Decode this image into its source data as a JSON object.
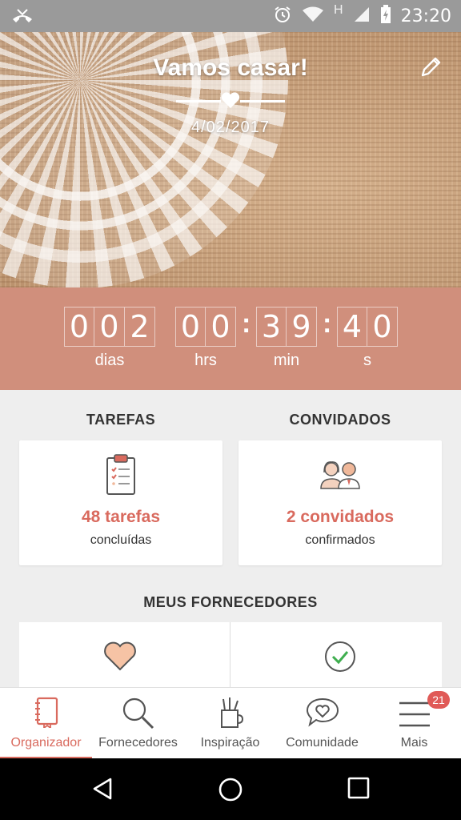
{
  "status_bar": {
    "time": "23:20",
    "network_letter": "H"
  },
  "hero": {
    "title": "Vamos casar!",
    "date": "4/02/2017"
  },
  "countdown": {
    "days": [
      "0",
      "0",
      "2"
    ],
    "hours": [
      "0",
      "0"
    ],
    "minutes": [
      "3",
      "9"
    ],
    "seconds": [
      "4",
      "0"
    ],
    "labels": {
      "days": "dias",
      "hours": "hrs",
      "minutes": "min",
      "seconds": "s"
    }
  },
  "tasks": {
    "heading": "TAREFAS",
    "count": "48 tarefas",
    "sub": "concluídas"
  },
  "guests": {
    "heading": "CONVIDADOS",
    "count": "2 convidados",
    "sub": "confirmados"
  },
  "suppliers": {
    "heading": "MEUS FORNECEDORES"
  },
  "bottom_nav": {
    "items": [
      {
        "label": "Organizador",
        "icon": "notebook-icon",
        "active": true
      },
      {
        "label": "Fornecedores",
        "icon": "search-icon"
      },
      {
        "label": "Inspiração",
        "icon": "pencil-cup-icon"
      },
      {
        "label": "Comunidade",
        "icon": "chat-heart-icon"
      },
      {
        "label": "Mais",
        "icon": "menu-icon",
        "badge": "21"
      }
    ]
  },
  "colors": {
    "accent": "#d96a5e",
    "countdown_bg": "#d08f7c",
    "status_bar": "#9a9a9a"
  }
}
